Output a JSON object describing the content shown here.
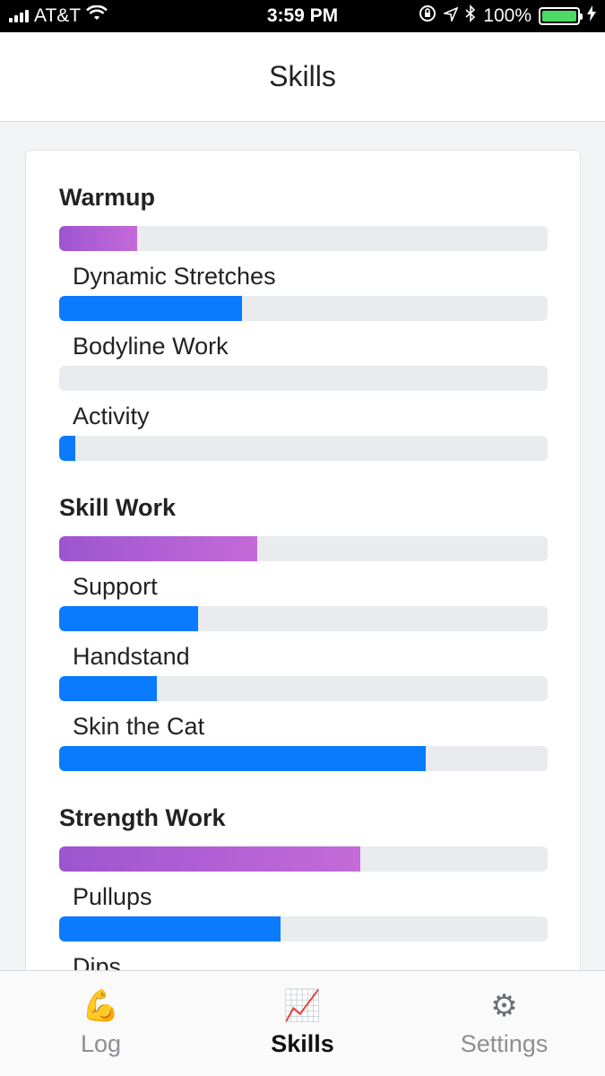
{
  "status_bar": {
    "carrier": "AT&T",
    "time": "3:59 PM",
    "battery": "100%"
  },
  "nav": {
    "title": "Skills"
  },
  "sections": [
    {
      "title": "Warmup",
      "progress": 0.16,
      "items": [
        {
          "label": "Dynamic Stretches",
          "progress": 0.375
        },
        {
          "label": "Bodyline Work",
          "progress": 0.0
        },
        {
          "label": "Activity",
          "progress": 0.033
        }
      ]
    },
    {
      "title": "Skill Work",
      "progress": 0.405,
      "items": [
        {
          "label": "Support",
          "progress": 0.285
        },
        {
          "label": "Handstand",
          "progress": 0.2
        },
        {
          "label": "Skin the Cat",
          "progress": 0.75
        }
      ]
    },
    {
      "title": "Strength Work",
      "progress": 0.617,
      "items": [
        {
          "label": "Pullups",
          "progress": 0.453
        },
        {
          "label": "Dips",
          "progress": 0.0
        }
      ]
    }
  ],
  "tabs": [
    {
      "label": "Log",
      "icon": "flexed-biceps-icon",
      "glyph": "💪"
    },
    {
      "label": "Skills",
      "icon": "chart-increasing-icon",
      "glyph": "📈"
    },
    {
      "label": "Settings",
      "icon": "gear-icon",
      "glyph": "⚙"
    }
  ],
  "colors": {
    "section_bar_start": "#9d55cf",
    "section_bar_end": "#c46ad9",
    "item_bar": "#0a7bff",
    "track": "#e9ebee"
  }
}
